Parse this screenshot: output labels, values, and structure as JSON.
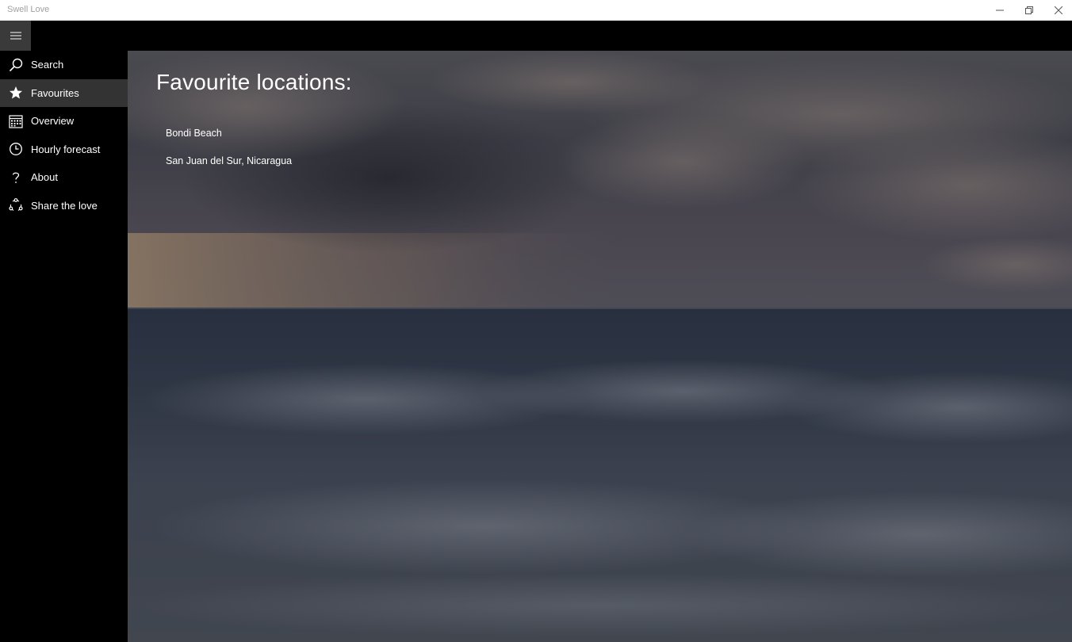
{
  "window": {
    "title": "Swell Love",
    "controls": [
      "minimize-icon",
      "restore-icon",
      "close-icon"
    ]
  },
  "sidebar": {
    "items": [
      {
        "label": "Search",
        "icon": "search-icon"
      },
      {
        "label": "Favourites",
        "icon": "star-icon",
        "selected": true
      },
      {
        "label": "Overview",
        "icon": "calendar-icon"
      },
      {
        "label": "Hourly forecast",
        "icon": "clock-icon"
      },
      {
        "label": "About",
        "icon": "question-icon"
      },
      {
        "label": "Share the love",
        "icon": "share-icon"
      }
    ]
  },
  "main": {
    "title": "Favourite locations:",
    "favourites": [
      "Bondi Beach",
      "San Juan del Sur, Nicaragua"
    ]
  },
  "colors": {
    "sidebar_bg": "#000000",
    "selected_bg": "#333333",
    "hamburger_bg": "#3a3a3a",
    "text": "#ffffff"
  }
}
